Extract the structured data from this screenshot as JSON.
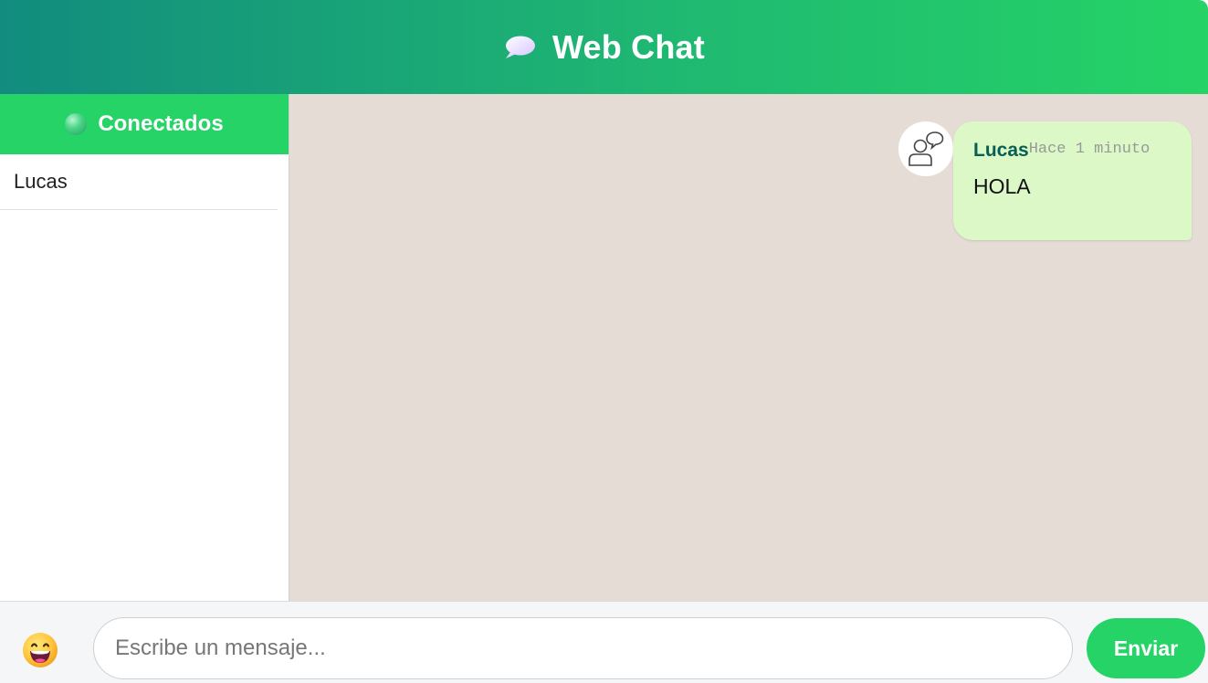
{
  "header": {
    "icon": "speech-balloon-icon",
    "title": "Web Chat"
  },
  "sidebar": {
    "title": "Conectados",
    "status_icon": "online-dot-icon",
    "users": [
      {
        "name": "Lucas"
      }
    ]
  },
  "chat": {
    "messages": [
      {
        "avatar_icon": "user-chat-icon",
        "sender": "Lucas",
        "time": "Hace 1 minuto",
        "text": "HOLA"
      }
    ]
  },
  "composer": {
    "emoji_icon": "grinning-face-icon",
    "placeholder": "Escribe un mensaje...",
    "value": "",
    "send_label": "Enviar"
  },
  "colors": {
    "brand_green": "#25d366",
    "header_gradient_start": "#128c7e",
    "chat_background": "#e5ddd5",
    "bubble_background": "#dcf8c6",
    "sender_color": "#075e54"
  }
}
